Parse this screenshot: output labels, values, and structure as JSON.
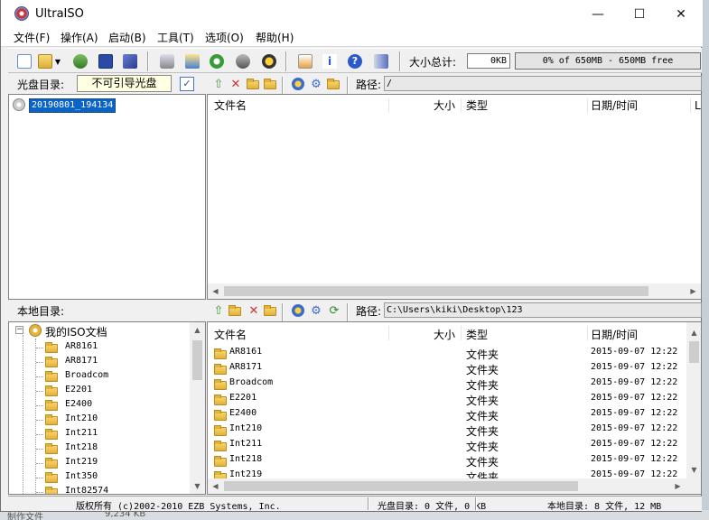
{
  "app": {
    "title": "UltraISO"
  },
  "window_controls": {
    "minimize": "—",
    "maximize": "☐",
    "close": "✕"
  },
  "menu": [
    "文件(F)",
    "操作(A)",
    "启动(B)",
    "工具(T)",
    "选项(O)",
    "帮助(H)"
  ],
  "toolbar": {
    "size_label": "大小总计:",
    "size_value": "0KB",
    "free_text": "0% of 650MB - 650MB free",
    "icons": [
      "new-file-icon",
      "open-icon",
      "open-dropdown-icon",
      "extract-icon",
      "save-icon",
      "save-as-icon",
      "burn-icon",
      "virtual-drive-icon",
      "make-cd-image-icon",
      "compress-icon",
      "mount-icon",
      "properties-icon",
      "info-icon",
      "help-icon",
      "exit-icon"
    ]
  },
  "disc": {
    "label": "光盘目录:",
    "boot_type": "不可引导光盘",
    "path_label": "路径:",
    "path": "/",
    "tree_root": "20190801_194134",
    "columns": [
      "文件名",
      "大小",
      "类型",
      "日期/时间",
      "L"
    ]
  },
  "local": {
    "label": "本地目录:",
    "path_label": "路径:",
    "path": "C:\\Users\\kiki\\Desktop\\123",
    "tree_root": "我的ISO文档",
    "tree_items": [
      "AR8161",
      "AR8171",
      "Broadcom",
      "E2201",
      "E2400",
      "Int210",
      "Int211",
      "Int218",
      "Int219",
      "Int350",
      "Int82574"
    ],
    "columns": [
      "文件名",
      "大小",
      "类型",
      "日期/时间"
    ],
    "files": [
      {
        "name": "AR8161",
        "type": "文件夹",
        "date": "2015-09-07 12:22"
      },
      {
        "name": "AR8171",
        "type": "文件夹",
        "date": "2015-09-07 12:22"
      },
      {
        "name": "Broadcom",
        "type": "文件夹",
        "date": "2015-09-07 12:22"
      },
      {
        "name": "E2201",
        "type": "文件夹",
        "date": "2015-09-07 12:22"
      },
      {
        "name": "E2400",
        "type": "文件夹",
        "date": "2015-09-07 12:22"
      },
      {
        "name": "Int210",
        "type": "文件夹",
        "date": "2015-09-07 12:22"
      },
      {
        "name": "Int211",
        "type": "文件夹",
        "date": "2015-09-07 12:22"
      },
      {
        "name": "Int218",
        "type": "文件夹",
        "date": "2015-09-07 12:22"
      },
      {
        "name": "Int219",
        "type": "文件夹",
        "date": "2015-09-07 12:22"
      }
    ]
  },
  "status": {
    "copyright": "版权所有 (c)2002-2010 EZB Systems, Inc.",
    "disc_summary": "光盘目录: 0 文件, 0 KB",
    "local_summary": "本地目录: 8 文件, 12 MB"
  },
  "background": {
    "bottom_left": "制作文件",
    "bottom_mid": "9,234 KB"
  }
}
